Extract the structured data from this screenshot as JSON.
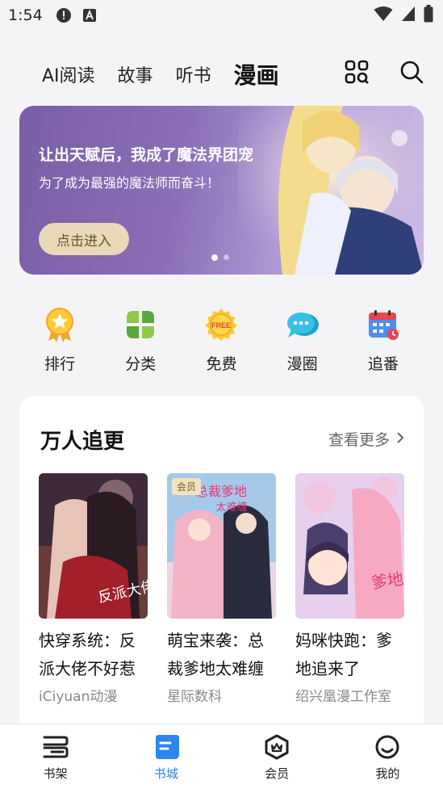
{
  "status_bar": {
    "time": "1:54"
  },
  "top_nav": {
    "tabs": [
      {
        "label": "AI阅读"
      },
      {
        "label": "故事"
      },
      {
        "label": "听书"
      },
      {
        "label": "漫画"
      }
    ],
    "active_tab": "漫画"
  },
  "banner": {
    "title": "让出天赋后，我成了魔法界团宠",
    "subtitle": "为了成为最强的魔法师而奋斗！",
    "button_label": "点击进入"
  },
  "categories": [
    {
      "label": "排行",
      "icon": "ranking-medal-icon"
    },
    {
      "label": "分类",
      "icon": "category-grid-icon"
    },
    {
      "label": "免费",
      "icon": "free-badge-icon"
    },
    {
      "label": "漫圈",
      "icon": "chat-bubbles-icon"
    },
    {
      "label": "追番",
      "icon": "calendar-icon"
    }
  ],
  "section": {
    "title": "万人追更",
    "see_more": "查看更多",
    "books": [
      {
        "title": "快穿系统：反派大佬不好惹",
        "author": "iCiyuan动漫",
        "badge": ""
      },
      {
        "title": "萌宝来袭：总裁爹地太难缠",
        "author": "星际数科",
        "badge": "会员"
      },
      {
        "title": "妈咪快跑：爹地追来了",
        "author": "绍兴凰漫工作室",
        "badge": ""
      }
    ]
  },
  "bottom_nav": {
    "items": [
      {
        "label": "书架"
      },
      {
        "label": "书城"
      },
      {
        "label": "会员"
      },
      {
        "label": "我的"
      }
    ],
    "active": "书城"
  },
  "colors": {
    "accent": "#2b86f0",
    "banner_purple": "#7a5ea6",
    "banner_button": "#e8d9b9"
  }
}
